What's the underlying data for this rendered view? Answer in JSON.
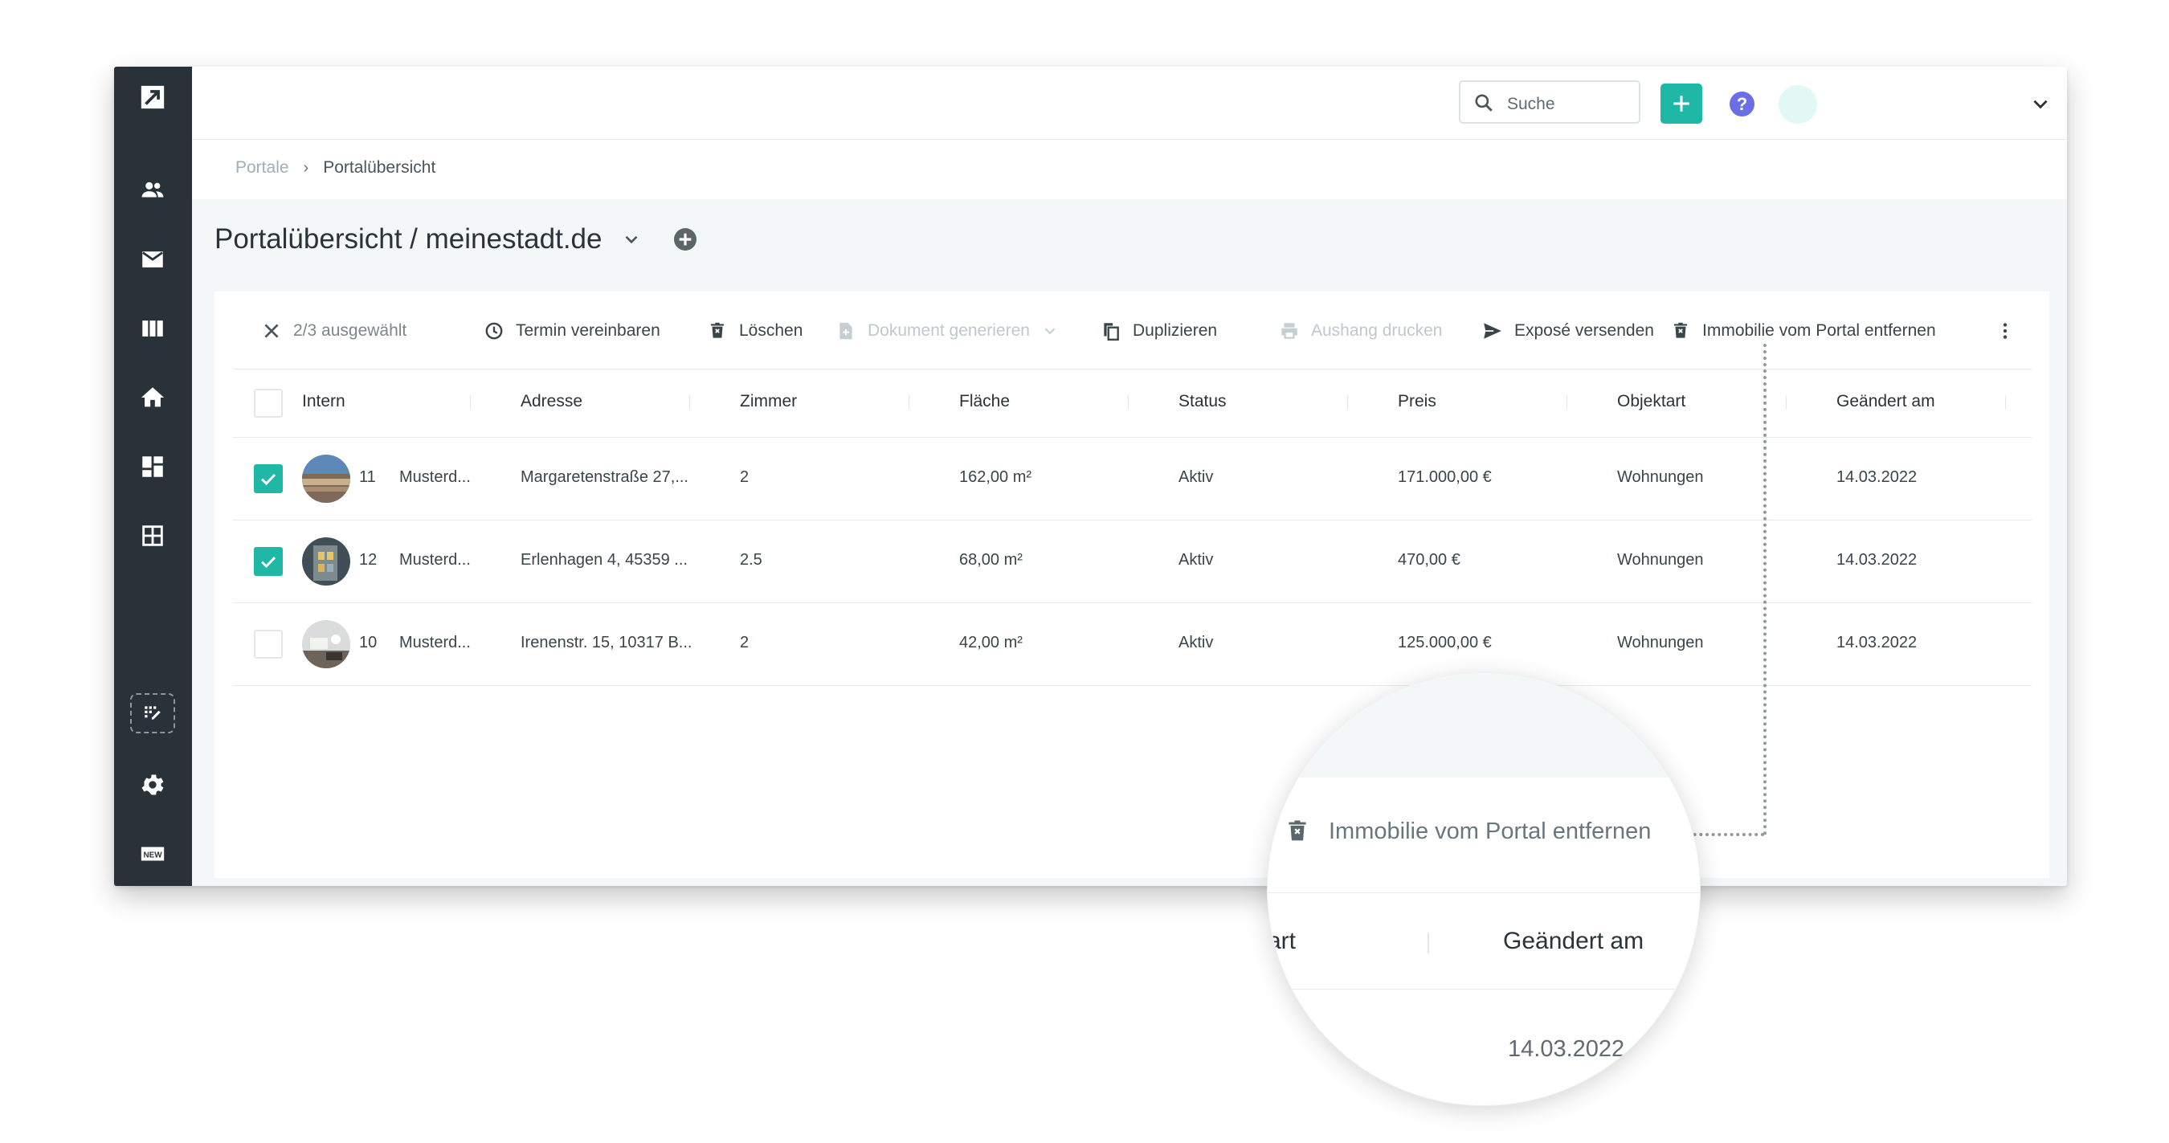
{
  "search": {
    "placeholder": "Suche"
  },
  "breadcrumb": {
    "parent": "Portale",
    "separator": "›",
    "current": "Portalübersicht"
  },
  "page": {
    "title": "Portalübersicht / meinestadt.de"
  },
  "toolbar": {
    "selection": "2/3 ausgewählt",
    "termin": "Termin vereinbaren",
    "loeschen": "Löschen",
    "dokument": "Dokument generieren",
    "duplizieren": "Duplizieren",
    "aushang": "Aushang drucken",
    "expose": "Exposé versenden",
    "entfernen": "Immobilie vom Portal entfernen"
  },
  "table": {
    "columns": [
      "Intern",
      "Adresse",
      "Zimmer",
      "Fläche",
      "Status",
      "Preis",
      "Objektart",
      "Geändert am"
    ],
    "rows": [
      {
        "checked": true,
        "id": "11",
        "name": "Musterd...",
        "adresse": "Margaretenstraße 27,...",
        "zimmer": "2",
        "flaeche": "162,00 m²",
        "status": "Aktiv",
        "preis": "171.000,00 €",
        "objektart": "Wohnungen",
        "geaendert": "14.03.2022"
      },
      {
        "checked": true,
        "id": "12",
        "name": "Musterd...",
        "adresse": "Erlenhagen 4, 45359 ...",
        "zimmer": "2.5",
        "flaeche": "68,00 m²",
        "status": "Aktiv",
        "preis": "470,00 €",
        "objektart": "Wohnungen",
        "geaendert": "14.03.2022"
      },
      {
        "checked": false,
        "id": "10",
        "name": "Musterd...",
        "adresse": "Irenenstr. 15, 10317 B...",
        "zimmer": "2",
        "flaeche": "42,00 m²",
        "status": "Aktiv",
        "preis": "125.000,00 €",
        "objektart": "Wohnungen",
        "geaendert": "14.03.2022"
      }
    ]
  },
  "magnifier": {
    "action": "Immobilie vom Portal entfernen",
    "col_partial": "̣art",
    "col_geaendert": "Geändert am",
    "date_partial": "14.03.2022"
  },
  "colors": {
    "accent": "#1fb7a5",
    "sidebar": "#283238",
    "help": "#6b6fe6"
  },
  "icons": {
    "sidebar": [
      "logo-icon",
      "contacts-icon",
      "mail-icon",
      "columns-icon",
      "home-icon",
      "dashboard-icon",
      "table-icon",
      "widgets-icon",
      "gear-icon",
      "new-badge-icon"
    ]
  }
}
